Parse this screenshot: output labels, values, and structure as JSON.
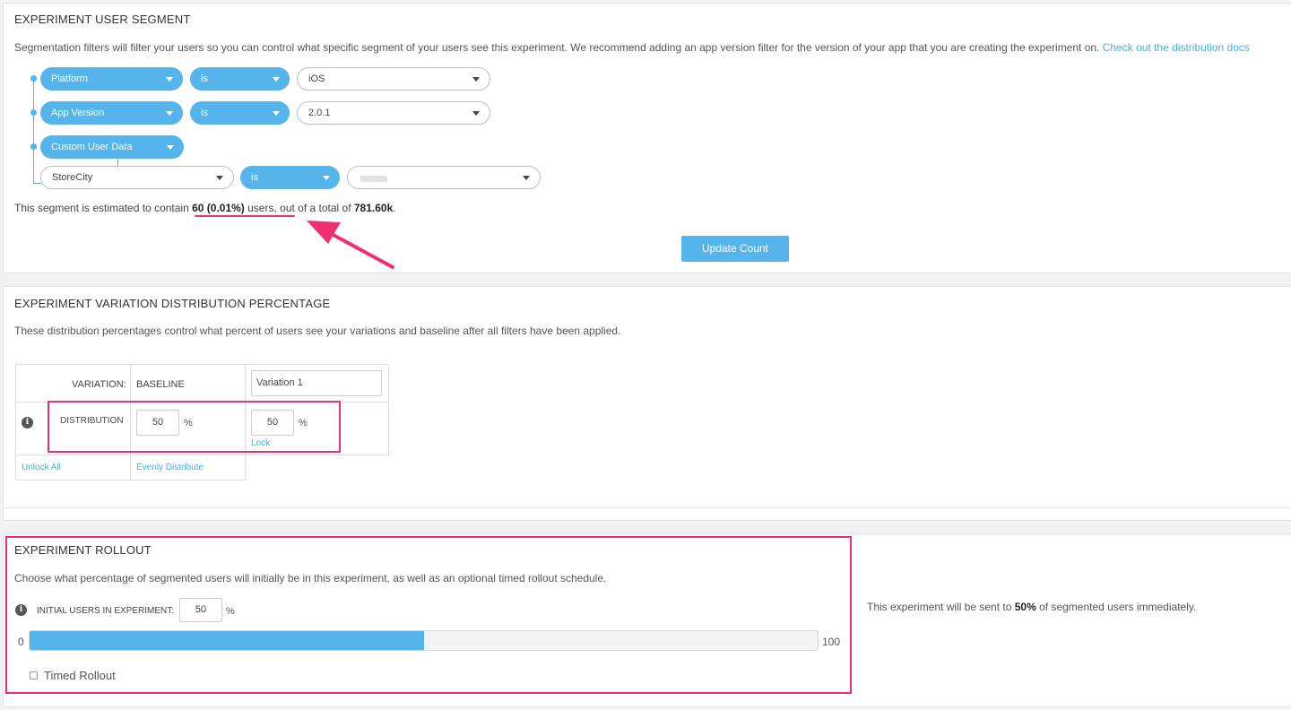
{
  "segment": {
    "title": "EXPERIMENT USER SEGMENT",
    "description": "Segmentation filters will filter your users so you can control what specific segment of your users see this experiment. We recommend adding an app version filter for the version of your app that you are creating the experiment on. ",
    "docs_link": "Check out the distribution docs",
    "filters": [
      {
        "field": "Platform",
        "operator": "is",
        "value": "iOS"
      },
      {
        "field": "App Version",
        "operator": "is",
        "value": "2.0.1"
      },
      {
        "field": "Custom User Data",
        "key": "StoreCity",
        "operator": "is",
        "value": ""
      }
    ],
    "estimate_prefix": "This segment is estimated to contain ",
    "estimate_count": "60 (0.01%)",
    "estimate_mid": " users, out of a total of ",
    "estimate_total": "781.60k",
    "estimate_suffix": ".",
    "update_button": "Update Count"
  },
  "distribution": {
    "title": "EXPERIMENT VARIATION DISTRIBUTION PERCENTAGE",
    "description": "These distribution percentages control what percent of users see your variations and baseline after all filters have been applied.",
    "variation_label": "VARIATION:",
    "baseline_label": "BASELINE",
    "variation1_name": "Variation 1",
    "distribution_label": "DISTRIBUTION",
    "baseline_value": "50",
    "variation1_value": "50",
    "percent": "%",
    "lock_label": "Lock",
    "unlock_all": "Unlock All",
    "evenly_distribute": "Evenly Distribute"
  },
  "rollout": {
    "title": "EXPERIMENT ROLLOUT",
    "description": "Choose what percentage of segmented users will initially be in this experiment, as well as an optional timed rollout schedule.",
    "initial_label": "INITIAL USERS IN EXPERIMENT:",
    "initial_value": "50",
    "percent": "%",
    "slider_min": "0",
    "slider_max": "100",
    "slider_fraction": 0.5,
    "timed_rollout": "Timed Rollout",
    "summary_prefix": "This experiment will be sent to ",
    "summary_value": "50%",
    "summary_suffix": " of segmented users immediately."
  },
  "colors": {
    "accent": "#56b4ec",
    "annotation": "#f0306e"
  }
}
